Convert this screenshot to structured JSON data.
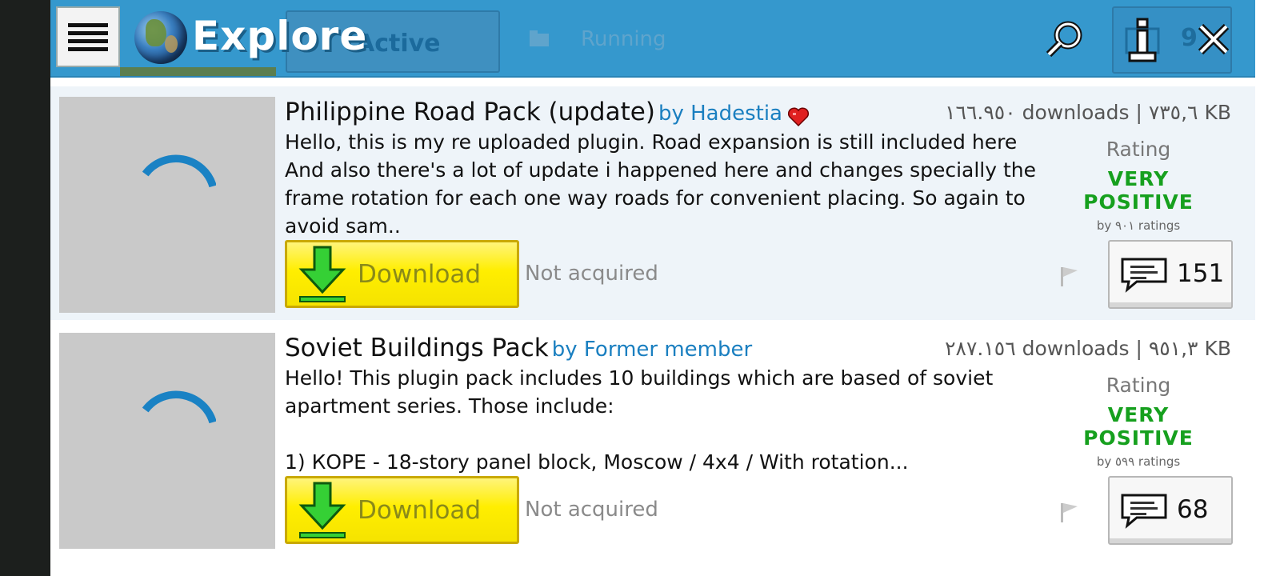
{
  "header": {
    "title": "Explore",
    "tabs": [
      {
        "label": "Active"
      },
      {
        "label": "Running"
      }
    ],
    "info_count": "9"
  },
  "plugins": [
    {
      "title": "Philippine Road Pack (update)",
      "author": "by Hadestia",
      "stats": "١٦٦.٩٥٠ downloads | ٧٣٥,٦ KB",
      "description": "Hello, this is my re uploaded plugin. Road expansion is still included here And also there's a lot of update i happened here and changes specially the frame rotation for each one way roads for convenient placing. So again to avoid sam..",
      "rating_label": "Rating",
      "rating_value": "VERY POSITIVE",
      "rating_count": "by ٩٠١ ratings",
      "download_label": "Download",
      "status": "Not acquired",
      "comments": "151"
    },
    {
      "title": "Soviet Buildings Pack",
      "author": "by Former member",
      "stats": "٢٨٧.١٥٦ downloads | ٩٥١,٣ KB",
      "description": "Hello! This plugin pack includes 10 buildings which are based of soviet apartment series. Those include:\n\n1) КОРЕ - 18-story panel block, Moscow / 4x4 / With rotation...",
      "rating_label": "Rating",
      "rating_value": "VERY POSITIVE",
      "rating_count": "by ٥٩٩ ratings",
      "download_label": "Download",
      "status": "Not acquired",
      "comments": "68"
    }
  ],
  "colors": {
    "header": "#3598cd",
    "link": "#1a7fc0",
    "rating_positive": "#16a01e",
    "download_button": "#ffee00"
  },
  "icons": [
    "menu-icon",
    "globe-icon",
    "folder-icon",
    "search-icon",
    "info-icon",
    "close-icon",
    "heart-icon",
    "spinner-icon",
    "download-arrow-icon",
    "flag-icon",
    "comment-icon"
  ]
}
